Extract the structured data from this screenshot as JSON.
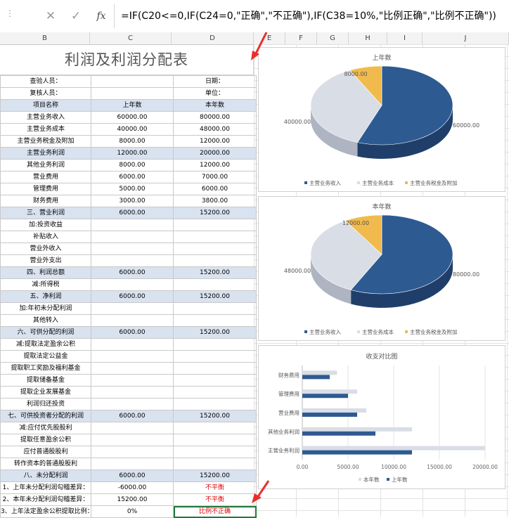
{
  "formula_bar": {
    "cancel_icon": "✕",
    "confirm_icon": "✓",
    "fx_label": "fx",
    "formula": "=IF(C20<=0,IF(C24=0,\"正确\",\"不正确\"),IF(C38=10%,\"比例正确\",\"比例不正确\"))"
  },
  "columns": [
    "B",
    "C",
    "D",
    "E",
    "F",
    "G",
    "H",
    "I",
    "J"
  ],
  "sheet": {
    "title": "利润及利润分配表",
    "rows": [
      {
        "a": "查验人员：",
        "b": "",
        "c": "日期：",
        "hl": false
      },
      {
        "a": "复核人员：",
        "b": "",
        "c": "单位：",
        "hl": false
      },
      {
        "a": "项目名称",
        "b": "上年数",
        "c": "本年数",
        "hl": true
      },
      {
        "a": "主营业务收入",
        "b": "60000.00",
        "c": "80000.00",
        "hl": false
      },
      {
        "a": "主营业务成本",
        "b": "40000.00",
        "c": "48000.00",
        "hl": false
      },
      {
        "a": "主营业务税金及附加",
        "b": "8000.00",
        "c": "12000.00",
        "hl": false
      },
      {
        "a": "主营业务利润",
        "b": "12000.00",
        "c": "20000.00",
        "hl": true
      },
      {
        "a": "其他业务利润",
        "b": "8000.00",
        "c": "12000.00",
        "hl": false
      },
      {
        "a": "营业费用",
        "b": "6000.00",
        "c": "7000.00",
        "hl": false
      },
      {
        "a": "管理费用",
        "b": "5000.00",
        "c": "6000.00",
        "hl": false
      },
      {
        "a": "财务费用",
        "b": "3000.00",
        "c": "3800.00",
        "hl": false
      },
      {
        "a": "三、营业利润",
        "b": "6000.00",
        "c": "15200.00",
        "hl": true
      },
      {
        "a": "加:投资收益",
        "b": "",
        "c": "",
        "hl": false
      },
      {
        "a": "补贴收入",
        "b": "",
        "c": "",
        "hl": false
      },
      {
        "a": "营业外收入",
        "b": "",
        "c": "",
        "hl": false
      },
      {
        "a": "营业外支出",
        "b": "",
        "c": "",
        "hl": false
      },
      {
        "a": "四、利润总额",
        "b": "6000.00",
        "c": "15200.00",
        "hl": true
      },
      {
        "a": "减:所得税",
        "b": "",
        "c": "",
        "hl": false
      },
      {
        "a": "五、净利润",
        "b": "6000.00",
        "c": "15200.00",
        "hl": true
      },
      {
        "a": "加:年初未分配利润",
        "b": "",
        "c": "",
        "hl": false
      },
      {
        "a": "其他转入",
        "b": "",
        "c": "",
        "hl": false
      },
      {
        "a": "六、可供分配的利润",
        "b": "6000.00",
        "c": "15200.00",
        "hl": true
      },
      {
        "a": "减:提取法定盈余公积",
        "b": "",
        "c": "",
        "hl": false
      },
      {
        "a": "提取法定公益金",
        "b": "",
        "c": "",
        "hl": false
      },
      {
        "a": "提取职工奖励及福利基金",
        "b": "",
        "c": "",
        "hl": false
      },
      {
        "a": "提取储备基金",
        "b": "",
        "c": "",
        "hl": false
      },
      {
        "a": "提取企业发展基金",
        "b": "",
        "c": "",
        "hl": false
      },
      {
        "a": "利润归还投资",
        "b": "",
        "c": "",
        "hl": false
      },
      {
        "a": "七、可供投资者分配的利润",
        "b": "6000.00",
        "c": "15200.00",
        "hl": true
      },
      {
        "a": "减:应付优先股股利",
        "b": "",
        "c": "",
        "hl": false
      },
      {
        "a": "提取任意盈余公积",
        "b": "",
        "c": "",
        "hl": false
      },
      {
        "a": "应付普通股股利",
        "b": "",
        "c": "",
        "hl": false
      },
      {
        "a": "转作资本的普通股股利",
        "b": "",
        "c": "",
        "hl": false
      },
      {
        "a": "八、未分配利润",
        "b": "6000.00",
        "c": "15200.00",
        "hl": true
      },
      {
        "a": "1、上年未分配利润勾稽差异：",
        "b": "-6000.00",
        "c": "不平衡",
        "hl": false,
        "red": true
      },
      {
        "a": "2、本年未分配利润勾稽差异：",
        "b": "15200.00",
        "c": "不平衡",
        "hl": false,
        "red": true
      },
      {
        "a": "3、上年法定盈余公积提取比例：",
        "b": "0%",
        "c": "比例不正确",
        "hl": false,
        "red": true
      }
    ]
  },
  "colors": {
    "dark_blue": "#2e5a92",
    "light_gray": "#d9dde6",
    "gold": "#f0bb4c",
    "highlight": "#d9e2ef",
    "error": "#e00000",
    "arrow": "#e8302a"
  },
  "chart_data": [
    {
      "type": "pie",
      "title": "上年数",
      "labels": [
        "主营业务收入",
        "主营业务成本",
        "主营业务税金及附加"
      ],
      "values": [
        60000,
        40000,
        8000
      ],
      "data_labels": [
        "60000.00",
        "40000.00",
        "8000.00"
      ],
      "legend_position": "bottom"
    },
    {
      "type": "pie",
      "title": "本年数",
      "labels": [
        "主营业务收入",
        "主营业务成本",
        "主营业务税金及附加"
      ],
      "values": [
        80000,
        48000,
        12000
      ],
      "data_labels": [
        "80000.00",
        "48000.00",
        "12000.00"
      ],
      "legend_position": "bottom"
    },
    {
      "type": "bar",
      "orientation": "horizontal",
      "title": "收支对比图",
      "categories": [
        "主营业务利润",
        "其他业务利润",
        "营业费用",
        "管理费用",
        "财务费用"
      ],
      "series": [
        {
          "name": "本年数",
          "values": [
            20000,
            12000,
            7000,
            6000,
            3800
          ]
        },
        {
          "name": "上年数",
          "values": [
            12000,
            8000,
            6000,
            5000,
            3000
          ]
        }
      ],
      "xlim": [
        0,
        20000
      ],
      "tick_labels": [
        "0.00",
        "5000.00",
        "10000.00",
        "15000.00",
        "20000.00"
      ],
      "legend_position": "bottom",
      "grid": true
    }
  ]
}
